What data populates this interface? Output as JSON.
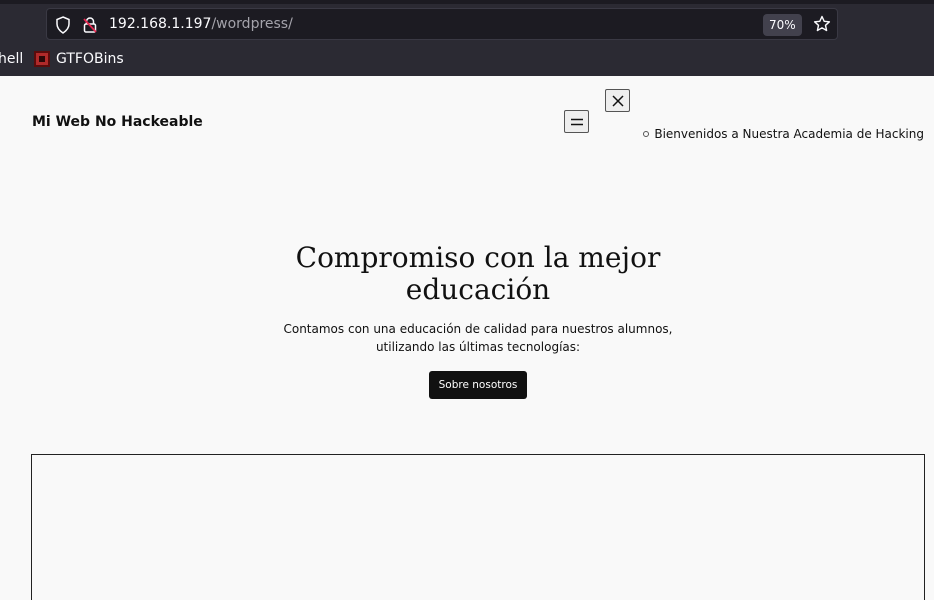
{
  "browser": {
    "url_host": "192.168.1.197",
    "url_path": "/wordpress/",
    "zoom": "70%",
    "bookmarks": [
      {
        "label": "hell"
      },
      {
        "label": "GTFOBins"
      }
    ]
  },
  "site": {
    "title": "Mi Web No Hackeable",
    "nav_item": "Bienvenidos a Nuestra Academia de Hacking"
  },
  "hero": {
    "title": "Compromiso con la mejor educación",
    "text": "Contamos con una educación de calidad para nuestros alumnos, utilizando las últimas tecnologías:",
    "button": "Sobre nosotros"
  },
  "colors": {
    "chrome_bg": "#2b2a33",
    "page_bg": "#f9f9f9",
    "button_bg": "#111111"
  }
}
